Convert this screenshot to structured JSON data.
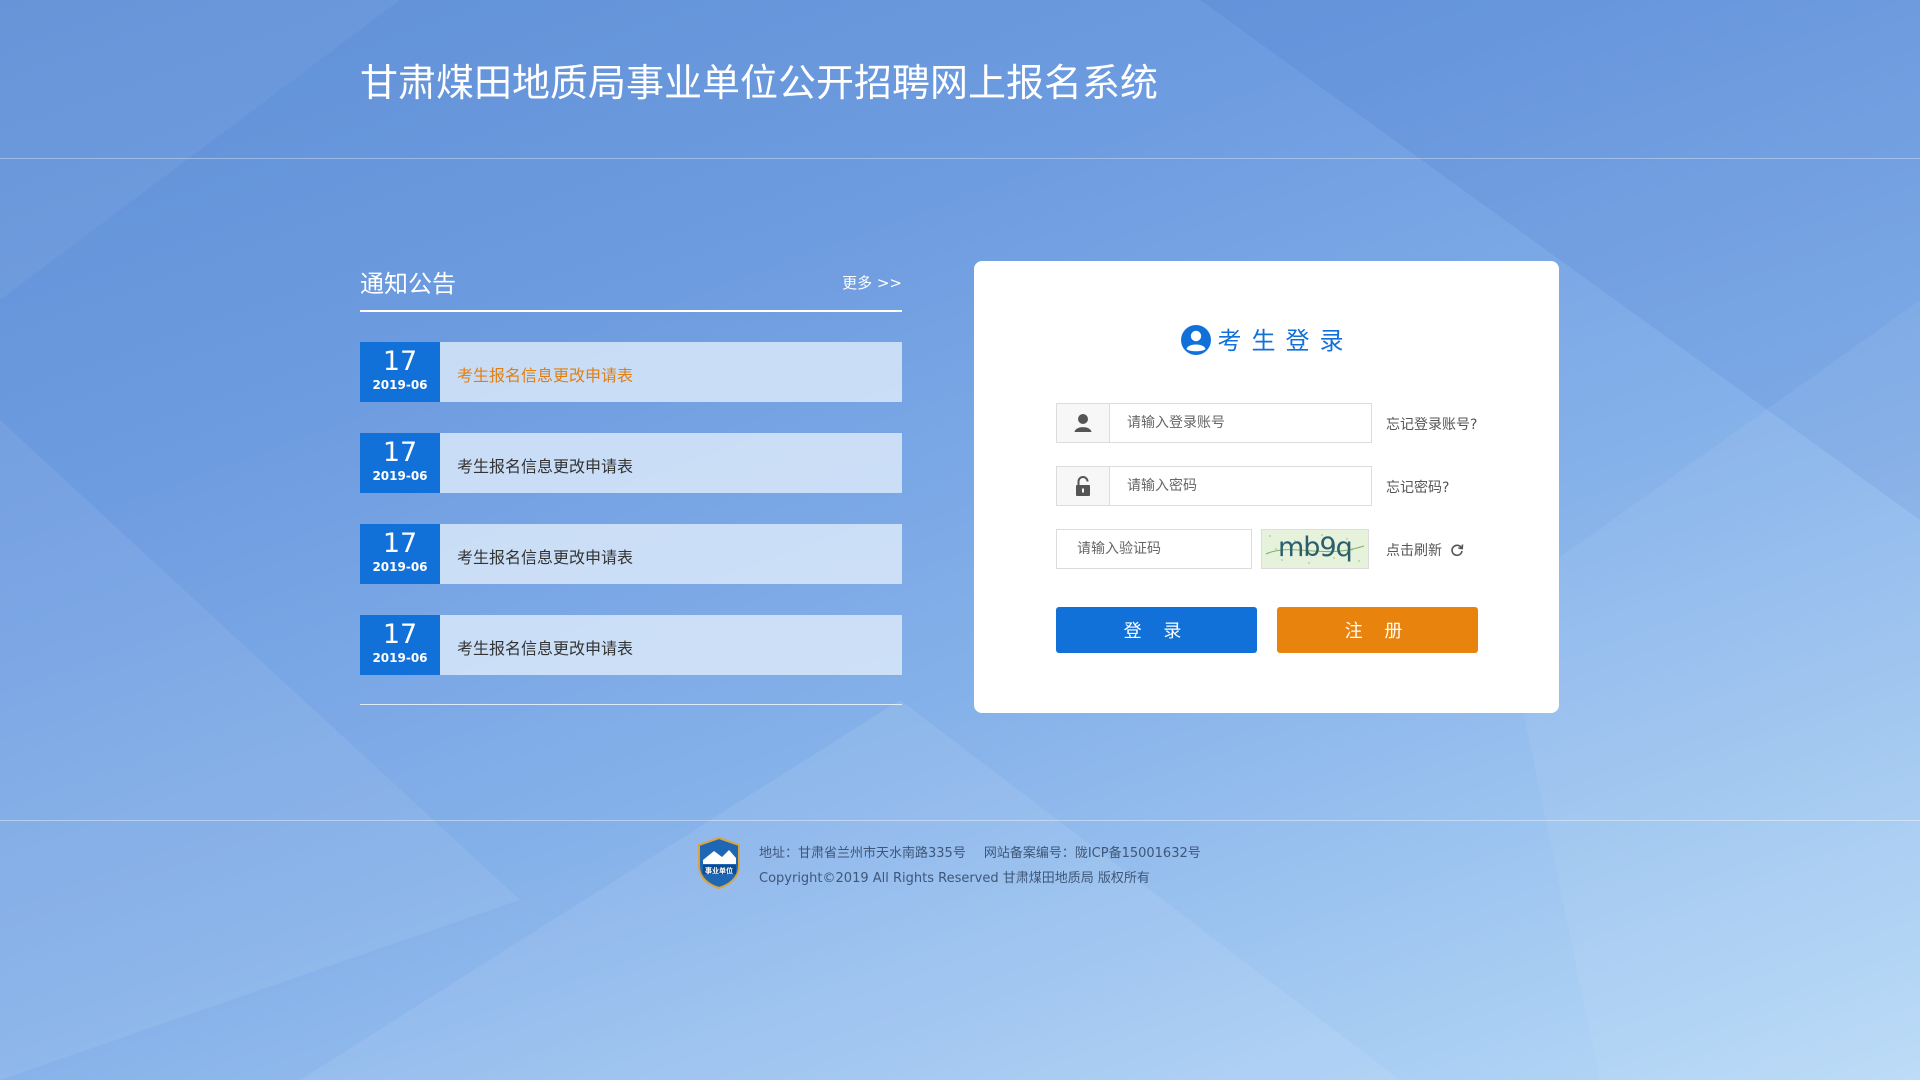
{
  "header": {
    "title": "甘肃煤田地质局事业单位公开招聘网上报名系统"
  },
  "notices": {
    "title": "通知公告",
    "more_label": "更多 >>",
    "items": [
      {
        "day": "17",
        "year_month": "2019-06",
        "text": "考生报名信息更改申请表",
        "active": true
      },
      {
        "day": "17",
        "year_month": "2019-06",
        "text": "考生报名信息更改申请表",
        "active": false
      },
      {
        "day": "17",
        "year_month": "2019-06",
        "text": "考生报名信息更改申请表",
        "active": false
      },
      {
        "day": "17",
        "year_month": "2019-06",
        "text": "考生报名信息更改申请表",
        "active": false
      }
    ]
  },
  "login": {
    "title": "考生登录",
    "account_placeholder": "请输入登录账号",
    "forgot_account": "忘记登录账号?",
    "password_placeholder": "请输入密码",
    "forgot_password": "忘记密码?",
    "captcha_placeholder": "请输入验证码",
    "captcha_text": "mb9q",
    "refresh_label": "点击刷新",
    "login_button": "登 录",
    "register_button": "注 册"
  },
  "footer": {
    "logo_text": "事业单位",
    "address": "地址：甘肃省兰州市天水南路335号",
    "icp": "网站备案编号：陇ICP备15001632号",
    "copyright": "Copyright©2019 All Rights Reserved 甘肃煤田地质局 版权所有"
  },
  "colors": {
    "primary": "#1171d9",
    "accent": "#e8830d",
    "notice_active_text": "#e07f12"
  },
  "icons": {
    "user_badge": "user-circle-icon",
    "account_field": "user-icon",
    "password_field": "lock-icon",
    "refresh": "refresh-icon"
  }
}
